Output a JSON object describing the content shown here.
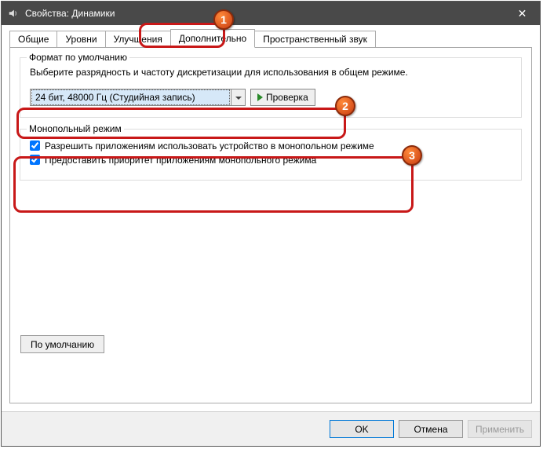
{
  "window": {
    "title": "Свойства: Динамики",
    "close_glyph": "✕"
  },
  "tabs": {
    "general": "Общие",
    "levels": "Уровни",
    "enhancements": "Улучшения",
    "advanced": "Дополнительно",
    "spatial": "Пространственный звук"
  },
  "default_format": {
    "legend": "Формат по умолчанию",
    "description": "Выберите разрядность и частоту дискретизации для использования в общем режиме.",
    "selected": "24 бит, 48000 Гц (Студийная запись)",
    "test_button": "Проверка"
  },
  "exclusive": {
    "legend": "Монопольный режим",
    "allow_label": "Разрешить приложениям использовать устройство в монопольном режиме",
    "priority_label": "Предоставить приоритет приложениям монопольного режима"
  },
  "restore_defaults": "По умолчанию",
  "buttons": {
    "ok": "OK",
    "cancel": "Отмена",
    "apply": "Применить"
  },
  "annotations": {
    "n1": "1",
    "n2": "2",
    "n3": "3"
  }
}
